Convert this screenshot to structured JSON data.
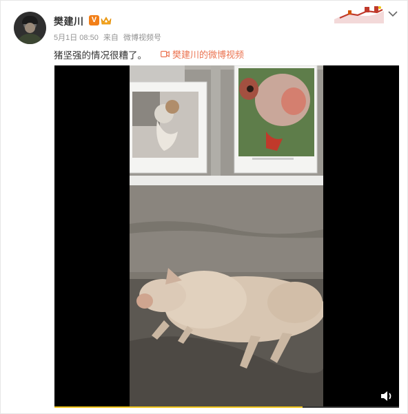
{
  "user": {
    "name": "樊建川",
    "verified_badge": "V"
  },
  "meta": {
    "time": "5月1日 08:50",
    "source_prefix": "来自",
    "source": "微博视频号"
  },
  "post": {
    "text": "猪坚强的情况很糟了。",
    "video_link": "樊建川的微博视频"
  },
  "video": {
    "progress": 0.72,
    "accent_color": "#f0c419",
    "link_color": "#eb7350"
  }
}
